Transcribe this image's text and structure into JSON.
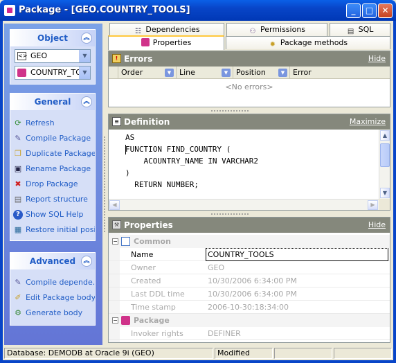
{
  "window": {
    "title": "Package - [GEO.COUNTRY_TOOLS]"
  },
  "nav": {
    "object": {
      "header": "Object",
      "schema_value": "GEO",
      "object_value": "COUNTRY_TO"
    },
    "general": {
      "header": "General",
      "items": [
        {
          "label": "Refresh",
          "icon": "refresh-icon"
        },
        {
          "label": "Compile Package",
          "icon": "compile-icon"
        },
        {
          "label": "Duplicate Package",
          "icon": "duplicate-icon"
        },
        {
          "label": "Rename Package",
          "icon": "rename-icon"
        },
        {
          "label": "Drop Package",
          "icon": "drop-icon"
        },
        {
          "label": "Report structure",
          "icon": "report-icon"
        },
        {
          "label": "Show SQL Help",
          "icon": "help-icon"
        },
        {
          "label": "Restore initial posi...",
          "icon": "restore-icon"
        }
      ]
    },
    "advanced": {
      "header": "Advanced",
      "items": [
        {
          "label": "Compile depende...",
          "icon": "compile-deps-icon"
        },
        {
          "label": "Edit Package body",
          "icon": "edit-body-icon"
        },
        {
          "label": "Generate body",
          "icon": "generate-icon"
        }
      ]
    }
  },
  "tabs": {
    "dependencies": "Dependencies",
    "permissions": "Permissions",
    "sql": "SQL",
    "properties": "Properties",
    "package_methods": "Package methods"
  },
  "errors": {
    "title": "Errors",
    "action": "Hide",
    "columns": [
      "Order",
      "Line",
      "Position",
      "Error"
    ],
    "empty": "<No errors>"
  },
  "definition": {
    "title": "Definition",
    "action": "Maximize",
    "lines": [
      "AS",
      "FUNCTION FIND_COUNTRY (",
      "    ACOUNTRY_NAME IN VARCHAR2",
      ")",
      "  RETURN NUMBER;"
    ]
  },
  "properties": {
    "title": "Properties",
    "action": "Hide",
    "common_label": "Common",
    "package_label": "Package",
    "rows": [
      {
        "name": "Name",
        "value": "COUNTRY_TOOLS"
      },
      {
        "name": "Owner",
        "value": "GEO"
      },
      {
        "name": "Created",
        "value": "10/30/2006 6:34:00 PM"
      },
      {
        "name": "Last DDL time",
        "value": "10/30/2006 6:34:00 PM"
      },
      {
        "name": "Time stamp",
        "value": "2006-10-30:18:34:00"
      }
    ],
    "package_rows": [
      {
        "name": "Invoker rights",
        "value": "DEFINER"
      }
    ]
  },
  "status": {
    "database": "Database: DEMODB  at Oracle 9i (GEO)",
    "state": "Modified"
  }
}
